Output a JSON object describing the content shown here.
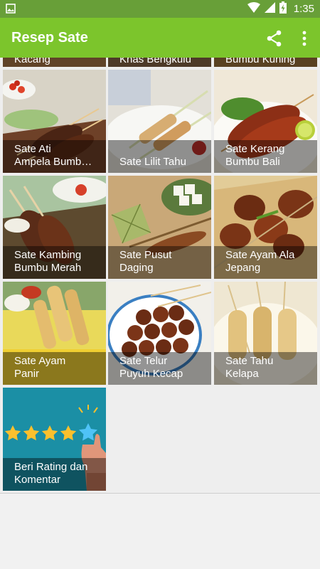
{
  "status_bar": {
    "time": "1:35",
    "icons": [
      "image-notification-icon",
      "wifi-icon",
      "signal-icon",
      "battery-charging-icon"
    ]
  },
  "app_bar": {
    "title": "Resep Sate",
    "actions": [
      "share-icon",
      "more-vert-icon"
    ]
  },
  "partial_top_row": [
    {
      "label": "Kacang"
    },
    {
      "label": "Khas Bengkulu"
    },
    {
      "label": "Bumbu Kuning"
    }
  ],
  "grid": [
    {
      "label": "Sate Ati\nAmpela Bumb…"
    },
    {
      "label": "Sate Lilit Tahu"
    },
    {
      "label": "Sate Kerang\nBumbu Bali"
    },
    {
      "label": "Sate Kambing\nBumbu Merah"
    },
    {
      "label": "Sate Pusut\nDaging"
    },
    {
      "label": "Sate Ayam Ala\nJepang"
    },
    {
      "label": "Sate Ayam\nPanir"
    },
    {
      "label": "Sate Telur\nPuyuh Kecap"
    },
    {
      "label": "Sate Tahu\nKelapa"
    },
    {
      "label": "Beri Rating dan\nKomentar"
    }
  ],
  "colors": {
    "status_bar": "#689f38",
    "app_bar": "#7cc52c",
    "rating_tile_bg": "#1b8fa5",
    "star": "#fbc02d"
  }
}
